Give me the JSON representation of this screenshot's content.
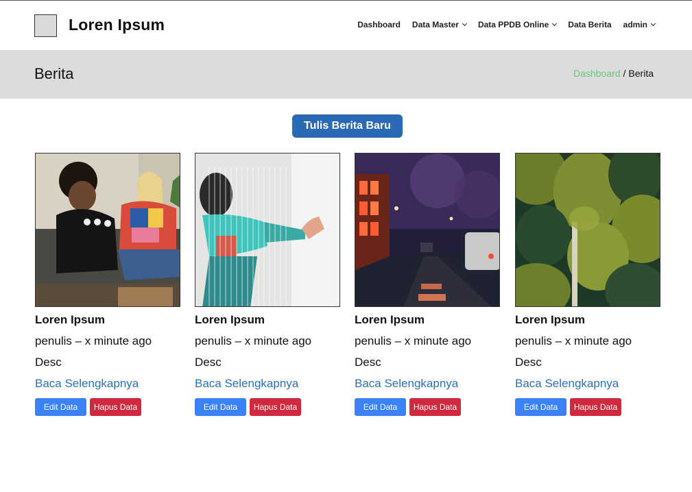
{
  "brand": {
    "name": "Loren Ipsum"
  },
  "nav": {
    "items": [
      {
        "label": "Dashboard",
        "dropdown": false
      },
      {
        "label": "Data Master",
        "dropdown": true
      },
      {
        "label": "Data PPDB Online",
        "dropdown": true
      },
      {
        "label": "Data Berita",
        "dropdown": false
      },
      {
        "label": "admin",
        "dropdown": true
      }
    ]
  },
  "header": {
    "title": "Berita",
    "breadcrumb": {
      "link": "Dashboard",
      "separator": "/",
      "current": "Berita"
    }
  },
  "actions": {
    "new_post_label": "Tulis Berita Baru"
  },
  "cards": [
    {
      "title": "Loren Ipsum",
      "meta": "penulis – x minute ago",
      "desc": "Desc",
      "link": "Baca Selengkapnya",
      "edit": "Edit Data",
      "delete": "Hapus Data",
      "image": "photo-two-women-talking-on-sofa"
    },
    {
      "title": "Loren Ipsum",
      "meta": "penulis – x minute ago",
      "desc": "Desc",
      "link": "Baca Selengkapnya",
      "edit": "Edit Data",
      "delete": "Hapus Data",
      "image": "photo-person-behind-ribbed-glass"
    },
    {
      "title": "Loren Ipsum",
      "meta": "penulis – x minute ago",
      "desc": "Desc",
      "link": "Baca Selengkapnya",
      "edit": "Edit Data",
      "delete": "Hapus Data",
      "image": "photo-night-street-lanterns"
    },
    {
      "title": "Loren Ipsum",
      "meta": "penulis – x minute ago",
      "desc": "Desc",
      "link": "Baca Selengkapnya",
      "edit": "Edit Data",
      "delete": "Hapus Data",
      "image": "photo-pine-forest-aerial"
    }
  ],
  "colors": {
    "primary": "#2a6ab5",
    "edit_button": "#3b82f6",
    "delete_button": "#d0283c",
    "breadcrumb_link": "#6cc47a",
    "header_band": "#dcdcdc",
    "link": "#2a72b5"
  }
}
